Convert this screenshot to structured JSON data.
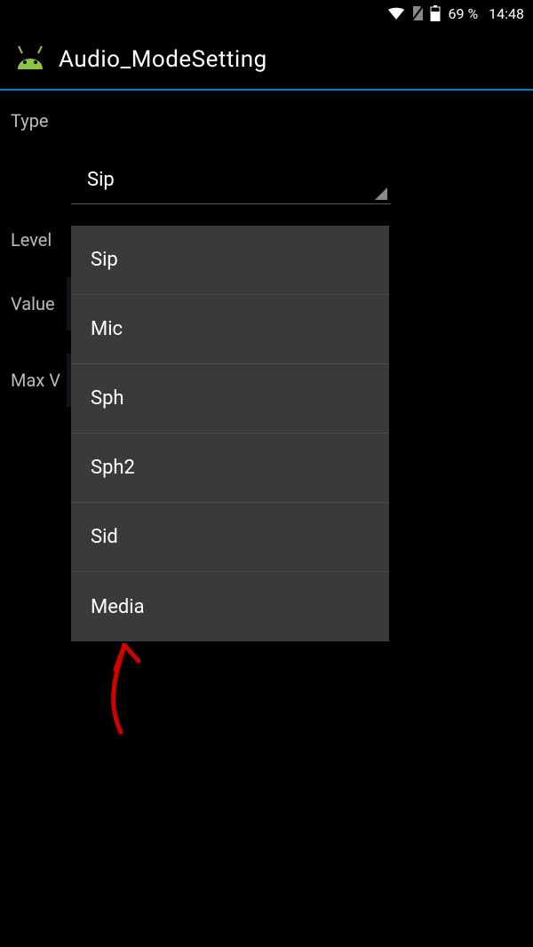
{
  "status_bar": {
    "battery_percent": "69 %",
    "time": "14:48"
  },
  "header": {
    "title": "Audio_ModeSetting"
  },
  "fields": {
    "type_label": "Type",
    "level_label": "Level",
    "value_label": "Value",
    "max_label": "Max V"
  },
  "spinner": {
    "selected": "Sip",
    "options": [
      "Sip",
      "Mic",
      "Sph",
      "Sph2",
      "Sid",
      "Media"
    ]
  }
}
